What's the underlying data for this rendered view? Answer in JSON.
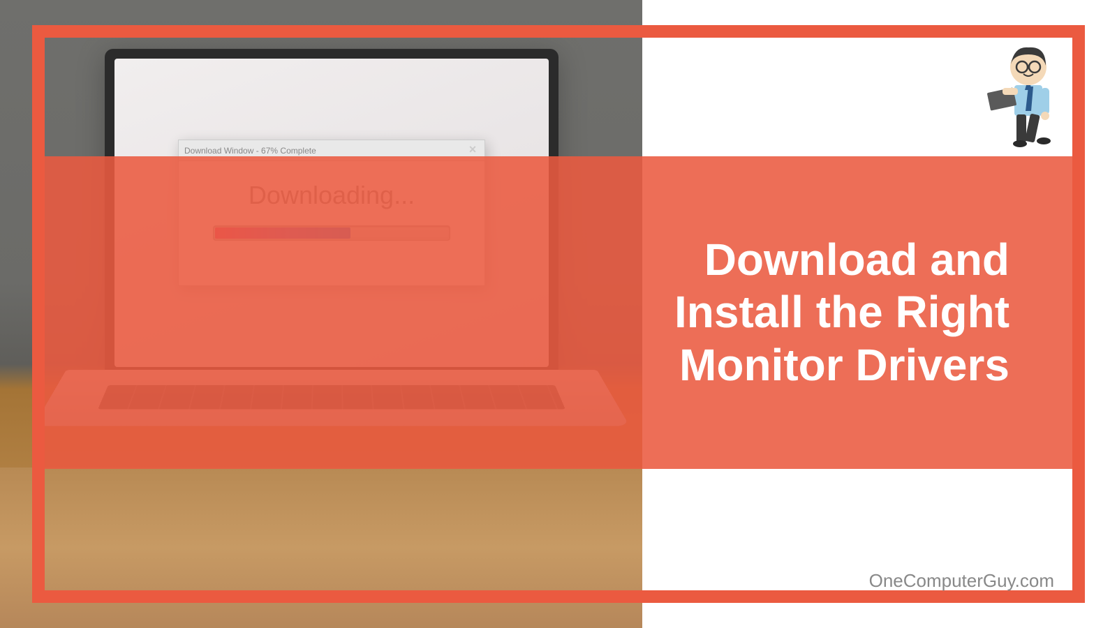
{
  "photo": {
    "download_window_title": "Download Window - 67% Complete",
    "download_window_close": "×",
    "downloading_text": "Downloading...",
    "progress_percent": 58
  },
  "overlay": {
    "title": "Download and Install the Right Monitor Drivers"
  },
  "attribution": "OneComputerGuy.com",
  "colors": {
    "accent": "#eb5a40",
    "overlay_rgba": "rgba(235,90,64,0.88)",
    "text_light": "#ffffff",
    "attribution_text": "#888888"
  },
  "mascot": {
    "label": "computer-guy-mascot"
  }
}
